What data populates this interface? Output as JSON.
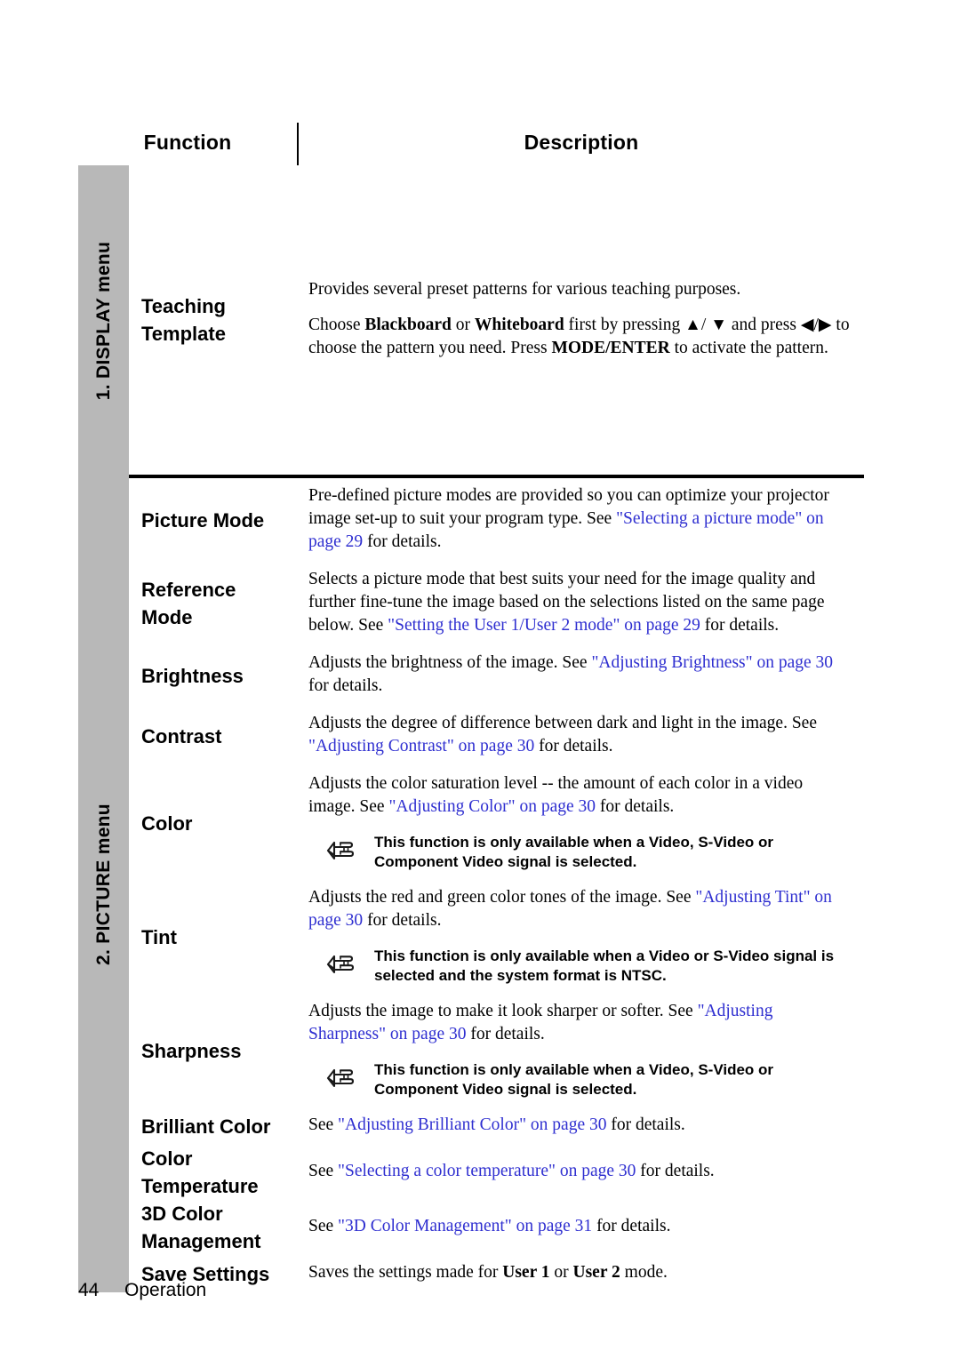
{
  "page": {
    "number": "44",
    "section": "Operation"
  },
  "table": {
    "headers": {
      "function": "Function",
      "description": "Description"
    },
    "sections": [
      {
        "rail_label": "1. DISPLAY menu",
        "rows": [
          {
            "function": "Teaching Template",
            "function_line1": "Teaching",
            "function_line2": "Template",
            "paragraphs": [
              "Provides several preset patterns for various teaching purposes."
            ],
            "instruction": {
              "t1": "Choose ",
              "b1": "Blackboard",
              "t2": " or ",
              "b2": "Whiteboard",
              "t3": " first by pressing ",
              "a1": "▲",
              "t4": "/ ",
              "a2": "▼",
              "t5": " and press ",
              "a3": "◀",
              "t6": "/",
              "a4": "▶",
              "t7": " to choose the pattern you need. Press ",
              "b3": "MODE/ENTER",
              "t8": " to activate the pattern."
            }
          }
        ]
      },
      {
        "rail_label": "2. PICTURE menu",
        "rows": [
          {
            "function": "Picture Mode",
            "desc": {
              "t1": "Pre-defined picture modes are provided so you can optimize your projector image set-up to suit your program type. See ",
              "link": "\"Selecting a picture mode\" on page 29",
              "t2": " for details."
            }
          },
          {
            "function": "Reference Mode",
            "function_line1": "Reference",
            "function_line2": "Mode",
            "desc": {
              "t1": "Selects a picture mode that best suits your need for the image quality and further fine-tune the image based on the selections listed on the same page below. See ",
              "link": "\"Setting the User 1/User 2 mode\" on page 29",
              "t2": " for details."
            }
          },
          {
            "function": "Brightness",
            "desc": {
              "t1": "Adjusts the brightness of the image. See ",
              "link": "\"Adjusting Brightness\" on page 30",
              "t2": " for details."
            }
          },
          {
            "function": "Contrast",
            "desc": {
              "t1": "Adjusts the degree of difference between dark and light in the image. See ",
              "link": "\"Adjusting Contrast\" on page 30",
              "t2": " for details."
            }
          },
          {
            "function": "Color",
            "desc": {
              "t1": "Adjusts the color saturation level -- the amount of each color in a video image. See ",
              "link": "\"Adjusting Color\" on page 30",
              "t2": " for details."
            },
            "note": {
              "icon": "pointing-hand-icon",
              "line1": "This function is only available when a Video, S-Video or",
              "line2": "Component Video signal is selected."
            }
          },
          {
            "function": "Tint",
            "desc": {
              "t1": "Adjusts the red and green color tones of the image. See ",
              "link": "\"Adjusting Tint\" on page 30",
              "t2": " for details."
            },
            "note": {
              "icon": "pointing-hand-icon",
              "line1": "This function is only available when a Video or S-Video signal is",
              "line2": "selected and the system format is NTSC."
            }
          },
          {
            "function": "Sharpness",
            "desc": {
              "t1": "Adjusts the image to make it look sharper or softer. See ",
              "link": "\"Adjusting Sharpness\" on page 30",
              "t2": " for details."
            },
            "note": {
              "icon": "pointing-hand-icon",
              "line1": "This function is only available when a Video, S-Video or",
              "line2": "Component Video signal is selected."
            }
          },
          {
            "function": "Brilliant Color",
            "desc": {
              "t1": "See ",
              "link": "\"Adjusting Brilliant Color\" on page 30",
              "t2": " for details."
            }
          },
          {
            "function": "Color Temperature",
            "function_line1": "Color",
            "function_line2": "Temperature",
            "desc": {
              "t1": "See ",
              "link": "\"Selecting a color temperature\" on page 30",
              "t2": " for details."
            }
          },
          {
            "function": "3D Color Management",
            "function_line1": "3D Color",
            "function_line2": "Management",
            "desc": {
              "t1": "See ",
              "link": "\"3D Color Management\" on page 31",
              "t2": " for details."
            }
          },
          {
            "function": "Save Settings",
            "save_desc": {
              "t1": "Saves the settings made for ",
              "b1": "User 1",
              "t2": " or ",
              "b2": "User 2",
              "t3": " mode."
            }
          }
        ]
      }
    ]
  },
  "colors": {
    "link": "#2f2fd0",
    "rail_background": "#b8b8b8",
    "text": "#000000"
  }
}
